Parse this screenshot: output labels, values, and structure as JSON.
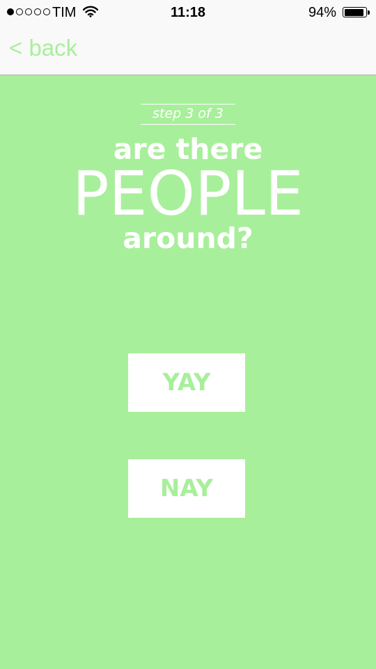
{
  "status_bar": {
    "signal_dots_filled": 1,
    "signal_dots_total": 5,
    "carrier": "TIM",
    "time": "11:18",
    "battery_percent": "94%",
    "battery_level": 0.94
  },
  "nav": {
    "back_label": "< back"
  },
  "step_label": "step 3 of 3",
  "question": {
    "line1": "are there",
    "line2": "PEOPLE",
    "line3": "around?"
  },
  "buttons": {
    "yes_label": "YAY",
    "no_label": "NAY"
  },
  "colors": {
    "accent": "#a8ef9b",
    "bar_background": "#f9f9f9",
    "text_on_accent": "#ffffff"
  }
}
